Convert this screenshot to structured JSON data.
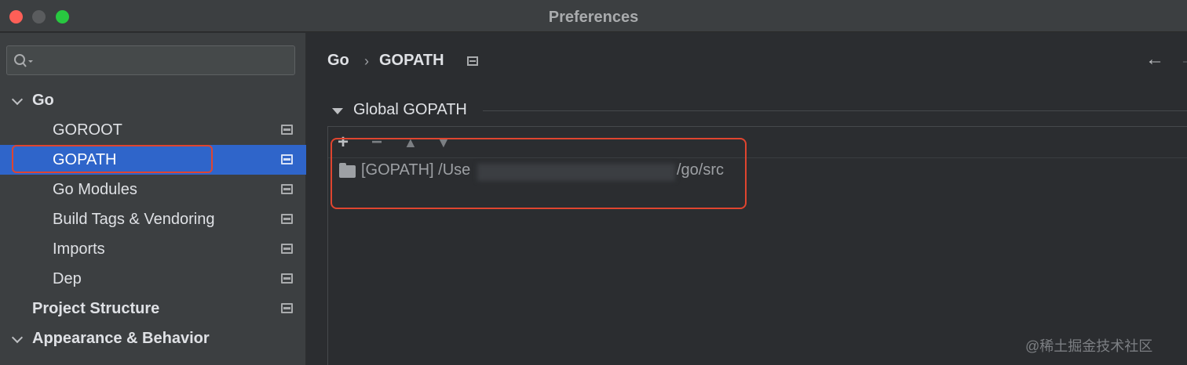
{
  "window": {
    "title": "Preferences"
  },
  "sidebar": {
    "search_placeholder": "",
    "items": [
      {
        "label": "Go",
        "level": 0,
        "expandable": true,
        "expanded": true,
        "bold": true,
        "has_page_icon": false,
        "selected": false
      },
      {
        "label": "GOROOT",
        "level": 1,
        "expandable": false,
        "bold": false,
        "has_page_icon": true,
        "selected": false
      },
      {
        "label": "GOPATH",
        "level": 1,
        "expandable": false,
        "bold": false,
        "has_page_icon": true,
        "selected": true
      },
      {
        "label": "Go Modules",
        "level": 1,
        "expandable": false,
        "bold": false,
        "has_page_icon": true,
        "selected": false
      },
      {
        "label": "Build Tags & Vendoring",
        "level": 1,
        "expandable": false,
        "bold": false,
        "has_page_icon": true,
        "selected": false
      },
      {
        "label": "Imports",
        "level": 1,
        "expandable": false,
        "bold": false,
        "has_page_icon": true,
        "selected": false
      },
      {
        "label": "Dep",
        "level": 1,
        "expandable": false,
        "bold": false,
        "has_page_icon": true,
        "selected": false
      },
      {
        "label": "Project Structure",
        "level": 0,
        "expandable": false,
        "bold": true,
        "has_page_icon": true,
        "selected": false
      },
      {
        "label": "Appearance & Behavior",
        "level": 0,
        "expandable": true,
        "expanded": true,
        "bold": true,
        "has_page_icon": false,
        "selected": false
      }
    ]
  },
  "main": {
    "breadcrumb": [
      "Go",
      "GOPATH"
    ],
    "breadcrumb_separator": "›",
    "nav": {
      "back_icon": "arrow-left-icon",
      "forward_icon": "arrow-right-icon"
    },
    "section": {
      "title": "Global GOPATH",
      "toolbar": [
        "add-icon",
        "remove-icon",
        "move-up-icon",
        "move-down-icon"
      ],
      "entries": [
        {
          "prefix": "[GOPATH] /Use",
          "suffix": "/go/src",
          "icon": "folder-icon"
        }
      ]
    }
  },
  "watermark": "@稀土掘金技术社区",
  "colors": {
    "selection": "#2f65ca",
    "annotation": "#e0452f"
  }
}
